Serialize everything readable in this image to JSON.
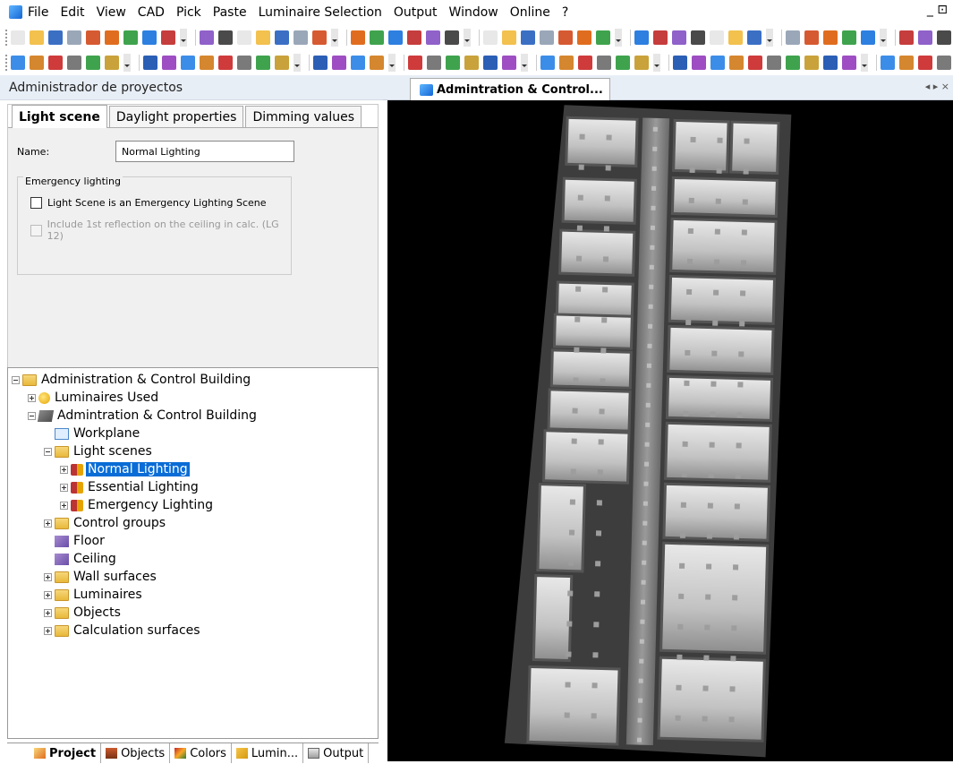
{
  "menu": {
    "items": [
      "File",
      "Edit",
      "View",
      "CAD",
      "Pick",
      "Paste",
      "Luminaire Selection",
      "Output",
      "Window",
      "Online",
      "?"
    ],
    "window_buttons": "_ ⊡"
  },
  "project_manager": {
    "title": "Administrador de proyectos",
    "tabs": [
      "Light scene",
      "Daylight properties",
      "Dimming values"
    ],
    "name_label": "Name:",
    "name_value": "Normal Lighting",
    "emergency_group_label": "Emergency lighting",
    "emergency_checkbox_label": "Light Scene is an Emergency Lighting Scene",
    "reflection_checkbox_label": "Include 1st reflection on the ceiling in calc. (LG 12)"
  },
  "tree": {
    "root": "Administration & Control Building",
    "luminaires_used": "Luminaires Used",
    "building": "Admintration & Control  Building",
    "workplane": "Workplane",
    "light_scenes": "Light scenes",
    "normal": "Normal Lighting",
    "essential": "Essential Lighting",
    "emergency": "Emergency Lighting",
    "control_groups": "Control groups",
    "floor": "Floor",
    "ceiling": "Ceiling",
    "wall_surfaces": "Wall surfaces",
    "luminaires": "Luminaires",
    "objects": "Objects",
    "calc_surfaces": "Calculation surfaces"
  },
  "bottom_tabs": [
    "Project",
    "Objects",
    "Colors",
    "Lumin...",
    "Output"
  ],
  "view": {
    "tab_title": "Admintration & Control...",
    "nav_arrows": "◂ ▸ ×"
  }
}
